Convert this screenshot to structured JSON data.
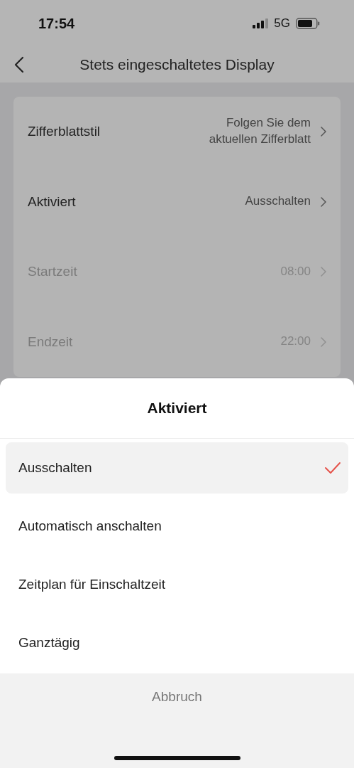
{
  "status_bar": {
    "time": "17:54",
    "network": "5G"
  },
  "nav": {
    "title": "Stets eingeschaltetes Display"
  },
  "settings": [
    {
      "label": "Zifferblattstil",
      "value": "Folgen Sie dem aktuellen Zifferblatt",
      "disabled": false
    },
    {
      "label": "Aktiviert",
      "value": "Ausschalten",
      "disabled": false
    },
    {
      "label": "Startzeit",
      "value": "08:00",
      "disabled": true
    },
    {
      "label": "Endzeit",
      "value": "22:00",
      "disabled": true
    }
  ],
  "sheet": {
    "title": "Aktiviert",
    "options": [
      {
        "label": "Ausschalten",
        "selected": true
      },
      {
        "label": "Automatisch anschalten",
        "selected": false
      },
      {
        "label": "Zeitplan für Einschaltzeit",
        "selected": false
      },
      {
        "label": "Ganztägig",
        "selected": false
      }
    ],
    "cancel": "Abbruch"
  }
}
